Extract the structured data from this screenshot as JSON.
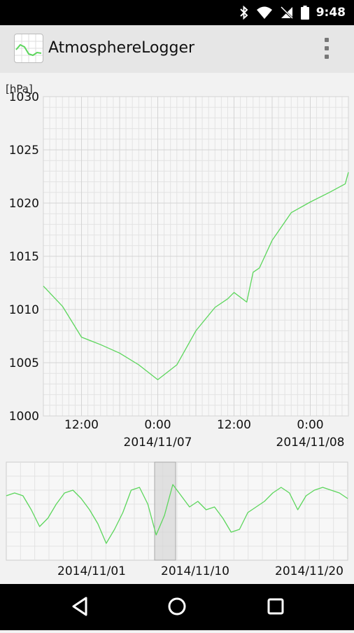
{
  "status_bar": {
    "time": "9:48",
    "icons": [
      "bluetooth-icon",
      "wifi-icon",
      "mute-icon",
      "battery-icon"
    ]
  },
  "action_bar": {
    "title": "AtmosphereLogger",
    "app_icon": "line-chart-app-icon",
    "overflow_icon": "more-vert-icon"
  },
  "chart_data": [
    {
      "type": "line",
      "ylabel": "[hPa]",
      "ylim": [
        1000,
        1030
      ],
      "y_ticks": [
        "1030",
        "1025",
        "1020",
        "1015",
        "1010",
        "1005",
        "1000"
      ],
      "x_ticks": [
        {
          "time": "12:00",
          "date": ""
        },
        {
          "time": "0:00",
          "date": "2014/11/07"
        },
        {
          "time": "12:00",
          "date": ""
        },
        {
          "time": "0:00",
          "date": "2014/11/08"
        }
      ],
      "series": [
        {
          "color": "#5cd65c",
          "x": [
            "2014/11/06 06:00",
            "2014/11/06 09:00",
            "2014/11/06 12:00",
            "2014/11/06 15:00",
            "2014/11/06 18:00",
            "2014/11/06 21:00",
            "2014/11/07 00:00",
            "2014/11/07 03:00",
            "2014/11/07 06:00",
            "2014/11/07 09:00",
            "2014/11/07 11:00",
            "2014/11/07 12:00",
            "2014/11/07 14:00",
            "2014/11/07 15:00",
            "2014/11/07 16:00",
            "2014/11/07 18:00",
            "2014/11/07 21:00",
            "2014/11/08 00:00",
            "2014/11/08 03:00",
            "2014/11/08 05:30",
            "2014/11/08 06:00"
          ],
          "y": [
            1012.2,
            1010.3,
            1007.4,
            1006.7,
            1005.9,
            1004.8,
            1003.4,
            1004.8,
            1008.0,
            1010.2,
            1011.0,
            1011.6,
            1010.7,
            1013.5,
            1013.9,
            1016.5,
            1019.1,
            1020.1,
            1021.0,
            1021.8,
            1022.9
          ]
        }
      ]
    },
    {
      "type": "line",
      "x_ticks": [
        "2014/11/01",
        "2014/11/10",
        "2014/11/20"
      ],
      "selected_range": [
        "2014/11/06 06:00",
        "2014/11/08 06:00"
      ],
      "series": [
        {
          "color": "#5cd65c",
          "y": [
            1018,
            1019,
            1018,
            1013,
            1007,
            1010,
            1015,
            1019,
            1020,
            1017,
            1013,
            1008,
            1001,
            1006,
            1012,
            1020,
            1021,
            1015,
            1004,
            1011,
            1022,
            1018,
            1014,
            1016,
            1013,
            1014,
            1010,
            1005,
            1006,
            1012,
            1014,
            1016,
            1019,
            1021,
            1019,
            1013,
            1018,
            1020,
            1021,
            1020,
            1019,
            1017
          ]
        }
      ]
    }
  ],
  "nav_bar": {
    "icons": [
      "back-icon",
      "home-icon",
      "recents-icon"
    ]
  }
}
